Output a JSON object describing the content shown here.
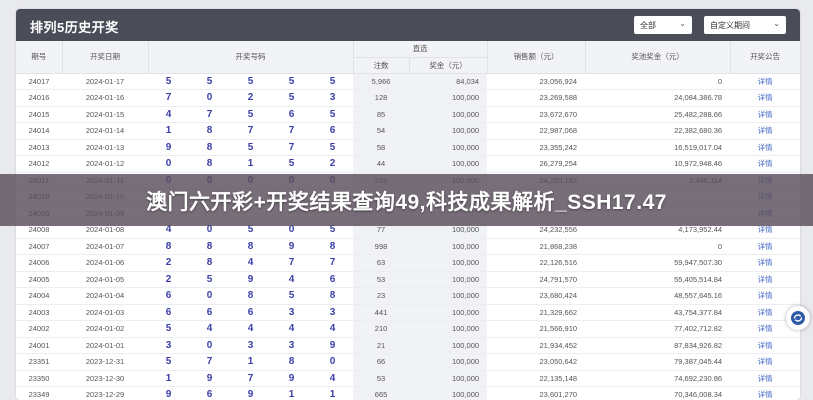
{
  "panel": {
    "title": "排列5历史开奖"
  },
  "filters": {
    "scope": "全部",
    "custom_range": "自定义期间"
  },
  "columns": {
    "issue": "期号",
    "date": "开奖日期",
    "numbers": "开奖号码",
    "direct": "直选",
    "winners": "注数",
    "prize": "奖金（元）",
    "sales": "销售额（元）",
    "pool": "奖池奖金（元）",
    "notice": "开奖公告"
  },
  "rows": [
    {
      "issue": "24017",
      "date": "2024-01-17",
      "n": [
        "5",
        "5",
        "5",
        "5",
        "5"
      ],
      "winners": "5,966",
      "prize": "84,034",
      "sales": "23,056,924",
      "pool": "0",
      "link": "详情"
    },
    {
      "issue": "24016",
      "date": "2024-01-16",
      "n": [
        "7",
        "0",
        "2",
        "5",
        "3"
      ],
      "winners": "128",
      "prize": "100,000",
      "sales": "23,269,588",
      "pool": "24,084,386.78",
      "link": "详情"
    },
    {
      "issue": "24015",
      "date": "2024-01-15",
      "n": [
        "4",
        "7",
        "5",
        "6",
        "5"
      ],
      "winners": "85",
      "prize": "100,000",
      "sales": "23,672,670",
      "pool": "25,482,288.66",
      "link": "详情"
    },
    {
      "issue": "24014",
      "date": "2024-01-14",
      "n": [
        "1",
        "8",
        "7",
        "7",
        "6"
      ],
      "winners": "54",
      "prize": "100,000",
      "sales": "22,987,068",
      "pool": "22,382,680.36",
      "link": "详情"
    },
    {
      "issue": "24013",
      "date": "2024-01-13",
      "n": [
        "9",
        "8",
        "5",
        "7",
        "5"
      ],
      "winners": "58",
      "prize": "100,000",
      "sales": "23,355,242",
      "pool": "16,519,017.04",
      "link": "详情"
    },
    {
      "issue": "24012",
      "date": "2024-01-12",
      "n": [
        "0",
        "8",
        "1",
        "5",
        "2"
      ],
      "winners": "44",
      "prize": "100,000",
      "sales": "26,279,254",
      "pool": "10,972,948.46",
      "link": "详情"
    },
    {
      "issue": "24011",
      "date": "2024-01-11",
      "n": [
        "0",
        "0",
        "0",
        "0",
        "0"
      ],
      "winners": "231",
      "prize": "100,000",
      "sales": "24,253,182",
      "pool": "2,496,114",
      "link": "详情"
    },
    {
      "issue": "24010",
      "date": "2024-01-10",
      "n": [
        "",
        "",
        "",
        "",
        "",
        ""
      ],
      "winners": "",
      "prize": "",
      "sales": "",
      "pool": "",
      "link": "详情"
    },
    {
      "issue": "24009",
      "date": "2024-01-09",
      "n": [
        "",
        "",
        "",
        "",
        ""
      ],
      "winners": "",
      "prize": "",
      "sales": "",
      "pool": "",
      "link": "详情"
    },
    {
      "issue": "24008",
      "date": "2024-01-08",
      "n": [
        "4",
        "0",
        "5",
        "0",
        "5"
      ],
      "winners": "77",
      "prize": "100,000",
      "sales": "24,232,556",
      "pool": "4,173,952.44",
      "link": "详情"
    },
    {
      "issue": "24007",
      "date": "2024-01-07",
      "n": [
        "8",
        "8",
        "8",
        "9",
        "8"
      ],
      "winners": "998",
      "prize": "100,000",
      "sales": "21,868,238",
      "pool": "0",
      "link": "详情"
    },
    {
      "issue": "24006",
      "date": "2024-01-06",
      "n": [
        "2",
        "8",
        "4",
        "7",
        "7"
      ],
      "winners": "63",
      "prize": "100,000",
      "sales": "22,126,516",
      "pool": "59,947,507.30",
      "link": "详情"
    },
    {
      "issue": "24005",
      "date": "2024-01-05",
      "n": [
        "2",
        "5",
        "9",
        "4",
        "6"
      ],
      "winners": "53",
      "prize": "100,000",
      "sales": "24,791,570",
      "pool": "55,405,514.84",
      "link": "详情"
    },
    {
      "issue": "24004",
      "date": "2024-01-04",
      "n": [
        "6",
        "0",
        "8",
        "5",
        "8"
      ],
      "winners": "23",
      "prize": "100,000",
      "sales": "23,680,424",
      "pool": "48,557,645.16",
      "link": "详情"
    },
    {
      "issue": "24003",
      "date": "2024-01-03",
      "n": [
        "6",
        "6",
        "6",
        "3",
        "3"
      ],
      "winners": "441",
      "prize": "100,000",
      "sales": "21,329,662",
      "pool": "43,754,377.84",
      "link": "详情"
    },
    {
      "issue": "24002",
      "date": "2024-01-02",
      "n": [
        "5",
        "4",
        "4",
        "4",
        "4"
      ],
      "winners": "210",
      "prize": "100,000",
      "sales": "21,566,910",
      "pool": "77,402,712.82",
      "link": "详情"
    },
    {
      "issue": "24001",
      "date": "2024-01-01",
      "n": [
        "3",
        "0",
        "3",
        "3",
        "9"
      ],
      "winners": "21",
      "prize": "100,000",
      "sales": "21,934,452",
      "pool": "87,834,926.82",
      "link": "详情"
    },
    {
      "issue": "23351",
      "date": "2023-12-31",
      "n": [
        "5",
        "7",
        "1",
        "8",
        "0"
      ],
      "winners": "66",
      "prize": "100,000",
      "sales": "23,050,642",
      "pool": "79,387,045.44",
      "link": "详情"
    },
    {
      "issue": "23350",
      "date": "2023-12-30",
      "n": [
        "1",
        "9",
        "7",
        "9",
        "4"
      ],
      "winners": "53",
      "prize": "100,000",
      "sales": "22,135,148",
      "pool": "74,692,230.86",
      "link": "详情"
    },
    {
      "issue": "23349",
      "date": "2023-12-29",
      "n": [
        "9",
        "6",
        "9",
        "1",
        "1"
      ],
      "winners": "665",
      "prize": "100,000",
      "sales": "23,601,270",
      "pool": "70,346,008.34",
      "link": "详情"
    }
  ],
  "banner": {
    "text": "澳门六开彩+开奖结果查询49,科技成果解析_SSH17.47"
  },
  "icons": {
    "float_button": "refresh-icon"
  }
}
